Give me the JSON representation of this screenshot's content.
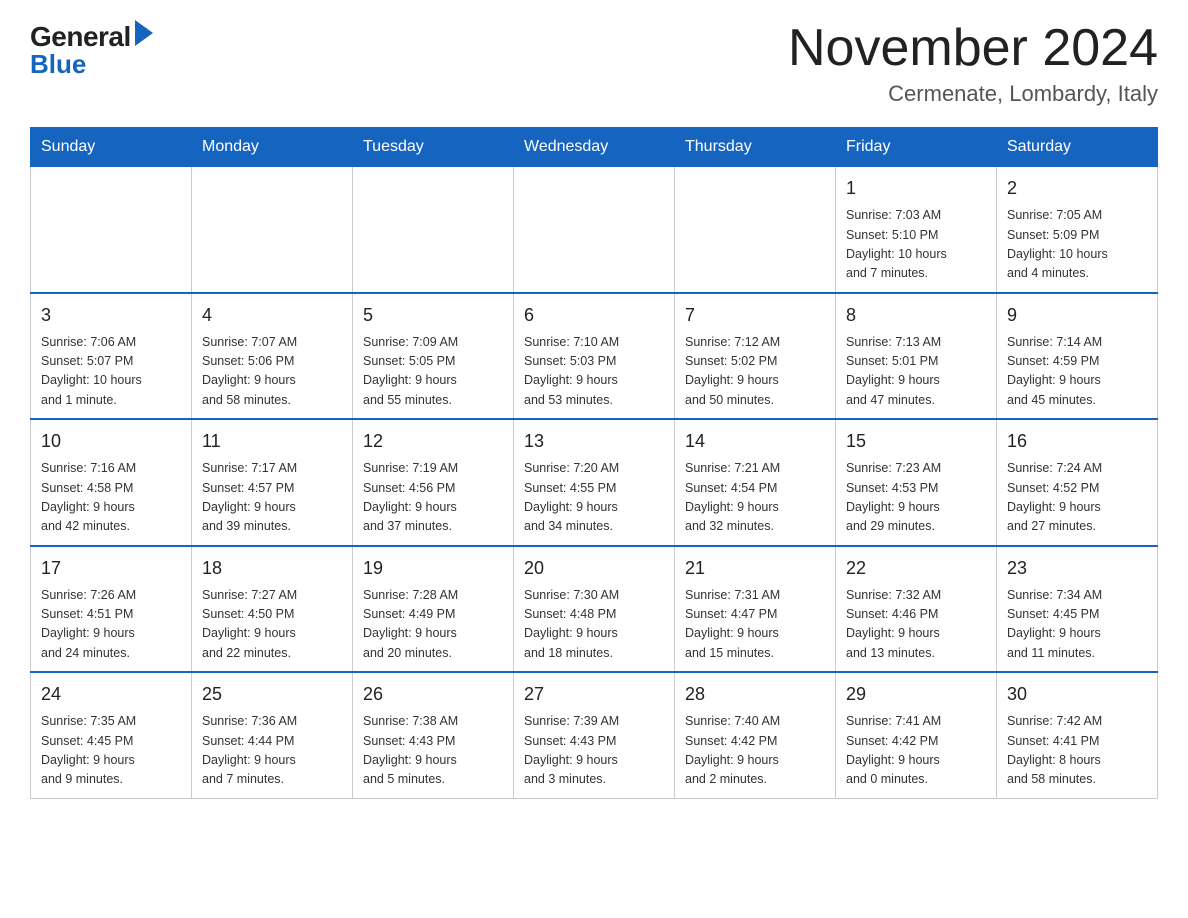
{
  "header": {
    "logo": {
      "general": "General",
      "blue": "Blue",
      "aria": "GeneralBlue logo"
    },
    "title": "November 2024",
    "subtitle": "Cermenate, Lombardy, Italy"
  },
  "calendar": {
    "weekdays": [
      "Sunday",
      "Monday",
      "Tuesday",
      "Wednesday",
      "Thursday",
      "Friday",
      "Saturday"
    ],
    "weeks": [
      {
        "days": [
          {
            "number": "",
            "info": "",
            "empty": true
          },
          {
            "number": "",
            "info": "",
            "empty": true
          },
          {
            "number": "",
            "info": "",
            "empty": true
          },
          {
            "number": "",
            "info": "",
            "empty": true
          },
          {
            "number": "",
            "info": "",
            "empty": true
          },
          {
            "number": "1",
            "info": "Sunrise: 7:03 AM\nSunset: 5:10 PM\nDaylight: 10 hours\nand 7 minutes.",
            "empty": false
          },
          {
            "number": "2",
            "info": "Sunrise: 7:05 AM\nSunset: 5:09 PM\nDaylight: 10 hours\nand 4 minutes.",
            "empty": false
          }
        ]
      },
      {
        "days": [
          {
            "number": "3",
            "info": "Sunrise: 7:06 AM\nSunset: 5:07 PM\nDaylight: 10 hours\nand 1 minute.",
            "empty": false
          },
          {
            "number": "4",
            "info": "Sunrise: 7:07 AM\nSunset: 5:06 PM\nDaylight: 9 hours\nand 58 minutes.",
            "empty": false
          },
          {
            "number": "5",
            "info": "Sunrise: 7:09 AM\nSunset: 5:05 PM\nDaylight: 9 hours\nand 55 minutes.",
            "empty": false
          },
          {
            "number": "6",
            "info": "Sunrise: 7:10 AM\nSunset: 5:03 PM\nDaylight: 9 hours\nand 53 minutes.",
            "empty": false
          },
          {
            "number": "7",
            "info": "Sunrise: 7:12 AM\nSunset: 5:02 PM\nDaylight: 9 hours\nand 50 minutes.",
            "empty": false
          },
          {
            "number": "8",
            "info": "Sunrise: 7:13 AM\nSunset: 5:01 PM\nDaylight: 9 hours\nand 47 minutes.",
            "empty": false
          },
          {
            "number": "9",
            "info": "Sunrise: 7:14 AM\nSunset: 4:59 PM\nDaylight: 9 hours\nand 45 minutes.",
            "empty": false
          }
        ]
      },
      {
        "days": [
          {
            "number": "10",
            "info": "Sunrise: 7:16 AM\nSunset: 4:58 PM\nDaylight: 9 hours\nand 42 minutes.",
            "empty": false
          },
          {
            "number": "11",
            "info": "Sunrise: 7:17 AM\nSunset: 4:57 PM\nDaylight: 9 hours\nand 39 minutes.",
            "empty": false
          },
          {
            "number": "12",
            "info": "Sunrise: 7:19 AM\nSunset: 4:56 PM\nDaylight: 9 hours\nand 37 minutes.",
            "empty": false
          },
          {
            "number": "13",
            "info": "Sunrise: 7:20 AM\nSunset: 4:55 PM\nDaylight: 9 hours\nand 34 minutes.",
            "empty": false
          },
          {
            "number": "14",
            "info": "Sunrise: 7:21 AM\nSunset: 4:54 PM\nDaylight: 9 hours\nand 32 minutes.",
            "empty": false
          },
          {
            "number": "15",
            "info": "Sunrise: 7:23 AM\nSunset: 4:53 PM\nDaylight: 9 hours\nand 29 minutes.",
            "empty": false
          },
          {
            "number": "16",
            "info": "Sunrise: 7:24 AM\nSunset: 4:52 PM\nDaylight: 9 hours\nand 27 minutes.",
            "empty": false
          }
        ]
      },
      {
        "days": [
          {
            "number": "17",
            "info": "Sunrise: 7:26 AM\nSunset: 4:51 PM\nDaylight: 9 hours\nand 24 minutes.",
            "empty": false
          },
          {
            "number": "18",
            "info": "Sunrise: 7:27 AM\nSunset: 4:50 PM\nDaylight: 9 hours\nand 22 minutes.",
            "empty": false
          },
          {
            "number": "19",
            "info": "Sunrise: 7:28 AM\nSunset: 4:49 PM\nDaylight: 9 hours\nand 20 minutes.",
            "empty": false
          },
          {
            "number": "20",
            "info": "Sunrise: 7:30 AM\nSunset: 4:48 PM\nDaylight: 9 hours\nand 18 minutes.",
            "empty": false
          },
          {
            "number": "21",
            "info": "Sunrise: 7:31 AM\nSunset: 4:47 PM\nDaylight: 9 hours\nand 15 minutes.",
            "empty": false
          },
          {
            "number": "22",
            "info": "Sunrise: 7:32 AM\nSunset: 4:46 PM\nDaylight: 9 hours\nand 13 minutes.",
            "empty": false
          },
          {
            "number": "23",
            "info": "Sunrise: 7:34 AM\nSunset: 4:45 PM\nDaylight: 9 hours\nand 11 minutes.",
            "empty": false
          }
        ]
      },
      {
        "days": [
          {
            "number": "24",
            "info": "Sunrise: 7:35 AM\nSunset: 4:45 PM\nDaylight: 9 hours\nand 9 minutes.",
            "empty": false
          },
          {
            "number": "25",
            "info": "Sunrise: 7:36 AM\nSunset: 4:44 PM\nDaylight: 9 hours\nand 7 minutes.",
            "empty": false
          },
          {
            "number": "26",
            "info": "Sunrise: 7:38 AM\nSunset: 4:43 PM\nDaylight: 9 hours\nand 5 minutes.",
            "empty": false
          },
          {
            "number": "27",
            "info": "Sunrise: 7:39 AM\nSunset: 4:43 PM\nDaylight: 9 hours\nand 3 minutes.",
            "empty": false
          },
          {
            "number": "28",
            "info": "Sunrise: 7:40 AM\nSunset: 4:42 PM\nDaylight: 9 hours\nand 2 minutes.",
            "empty": false
          },
          {
            "number": "29",
            "info": "Sunrise: 7:41 AM\nSunset: 4:42 PM\nDaylight: 9 hours\nand 0 minutes.",
            "empty": false
          },
          {
            "number": "30",
            "info": "Sunrise: 7:42 AM\nSunset: 4:41 PM\nDaylight: 8 hours\nand 58 minutes.",
            "empty": false
          }
        ]
      }
    ]
  }
}
